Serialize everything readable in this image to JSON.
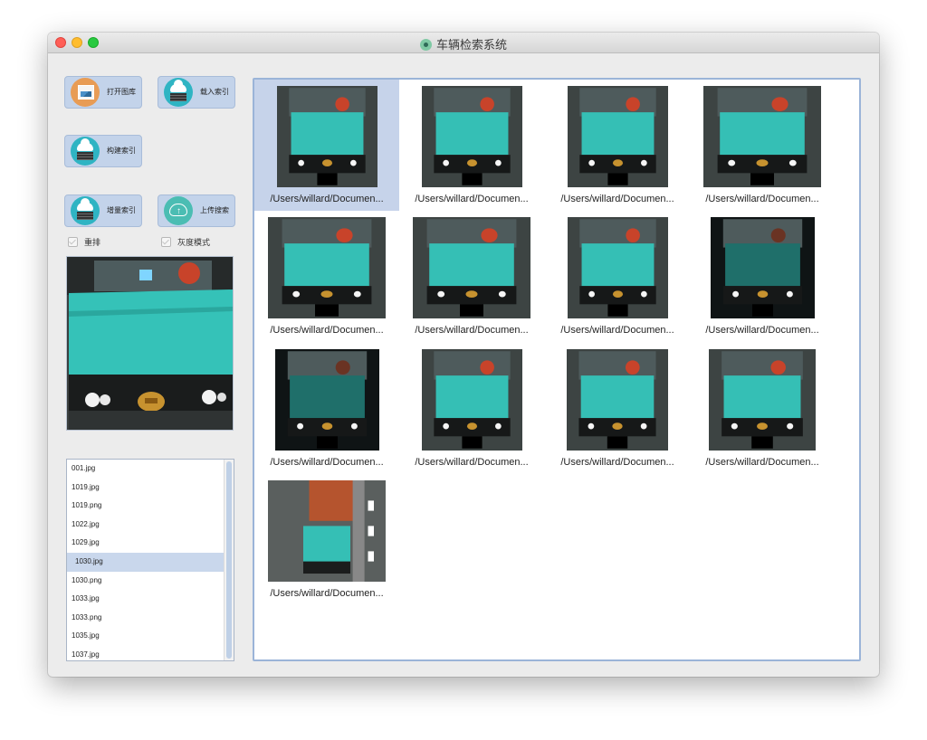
{
  "window": {
    "title": "车辆检索系统"
  },
  "toolbar": {
    "open_gallery": "打开图库",
    "load_index": "载入索引",
    "build_index": "构建索引",
    "incremental_index": "增量索引",
    "upload_search": "上传搜索"
  },
  "options": {
    "rerank": "重排",
    "grayscale": "灰度模式"
  },
  "file_list": [
    "001.jpg",
    "1019.jpg",
    "1019.png",
    "1022.jpg",
    "1029.jpg",
    "1030.jpg",
    "1030.png",
    "1033.jpg",
    "1033.png",
    "1035.jpg",
    "1037.jpg"
  ],
  "selected_file": "1030.jpg",
  "results": {
    "selected_index": 0,
    "items": [
      {
        "caption": "/Users/willard/Documen..."
      },
      {
        "caption": "/Users/willard/Documen..."
      },
      {
        "caption": "/Users/willard/Documen..."
      },
      {
        "caption": "/Users/willard/Documen..."
      },
      {
        "caption": "/Users/willard/Documen..."
      },
      {
        "caption": "/Users/willard/Documen..."
      },
      {
        "caption": "/Users/willard/Documen..."
      },
      {
        "caption": "/Users/willard/Documen..."
      },
      {
        "caption": "/Users/willard/Documen..."
      },
      {
        "caption": "/Users/willard/Documen..."
      },
      {
        "caption": "/Users/willard/Documen..."
      },
      {
        "caption": "/Users/willard/Documen..."
      },
      {
        "caption": "/Users/willard/Documen..."
      }
    ]
  },
  "colors": {
    "truck": "#35bfb5",
    "selection": "#c6d3ea",
    "accent": "#9bb4d8"
  }
}
